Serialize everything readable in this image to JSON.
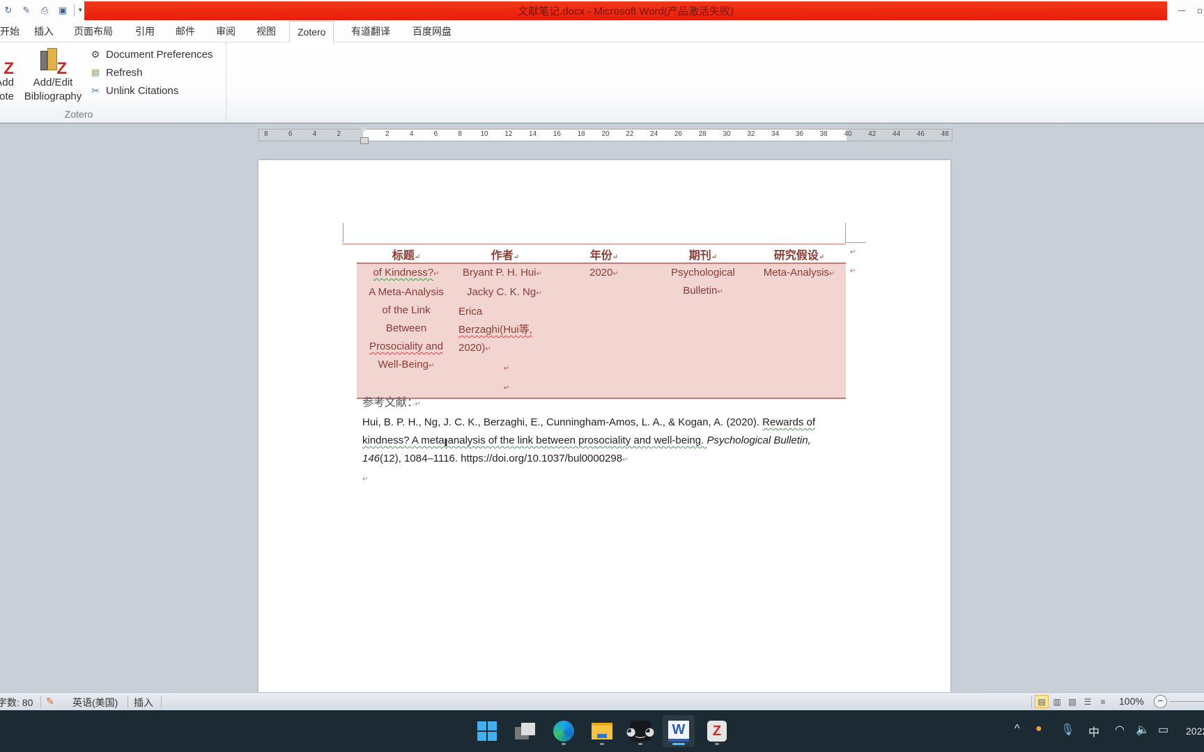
{
  "window": {
    "title": "文献笔记.docx - Microsoft Word(产品激活失败)",
    "title_bar_color": "#e81d0a",
    "minimize_icon": "minimize-icon",
    "maximize_icon": "maximize-icon"
  },
  "quick_access": {
    "items": [
      {
        "name": "redo-icon",
        "glyph": "↻"
      },
      {
        "name": "spellcheck-icon",
        "glyph": "✎"
      },
      {
        "name": "print-icon",
        "glyph": "⎙"
      },
      {
        "name": "print-preview-icon",
        "glyph": "▣"
      }
    ],
    "customize_glyph": "▾"
  },
  "ribbon_tabs": [
    {
      "label": "开始",
      "active": false
    },
    {
      "label": "插入",
      "active": false
    },
    {
      "label": "页面布局",
      "active": false
    },
    {
      "label": "引用",
      "active": false
    },
    {
      "label": "邮件",
      "active": false
    },
    {
      "label": "审阅",
      "active": false
    },
    {
      "label": "视图",
      "active": false
    },
    {
      "label": "Zotero",
      "active": true
    },
    {
      "label": "有道翻译",
      "active": false
    },
    {
      "label": "百度网盘",
      "active": false
    }
  ],
  "zotero_group": {
    "label": "Zotero",
    "add_note_line1": "Add",
    "add_note_line2": "Note",
    "add_bibliography_line1": "Add/Edit",
    "add_bibliography_line2": "Bibliography",
    "document_preferences": "Document Preferences",
    "refresh": "Refresh",
    "unlink_citations": "Unlink Citations"
  },
  "ruler": {
    "left_ticks": [
      "8",
      "6",
      "4",
      "2"
    ],
    "right_ticks": [
      "2",
      "4",
      "6",
      "8",
      "10",
      "12",
      "14",
      "16",
      "18",
      "20",
      "22",
      "24",
      "26",
      "28",
      "30",
      "32",
      "34",
      "36",
      "38",
      "40",
      "42",
      "44",
      "46",
      "48"
    ]
  },
  "document": {
    "table": {
      "headers": [
        "标题",
        "作者",
        "年份",
        "期刊",
        "研究假设"
      ],
      "row": {
        "title_lines": [
          "of Kindness?",
          "A Meta-Analysis",
          "of the Link",
          "Between",
          "Prosociality and",
          "Well-Being"
        ],
        "author_lines": [
          "Bryant P. H. Hui",
          "Jacky C. K. Ng",
          "Erica",
          "Berzaghi(Hui等,",
          "2020)"
        ],
        "year": "2020",
        "journal_lines": [
          "Psychological",
          "Bulletin"
        ],
        "hypothesis": "Meta-Analysis"
      },
      "text_color": "#8c3a33",
      "fill_color": "#f2d5d1"
    },
    "references_label": "参考文献：",
    "reference": {
      "authors": "Hui, B. P. H., Ng, J. C. K., Berzaghi, E., Cunningham-Amos, L. A., & Kogan, A. (2020). ",
      "title_part1": "Rewards of",
      "title_part2": "kindness? A meta-analysis of the link between prosociality and well-being. ",
      "journal": "Psychological Bulletin,",
      "volume": "146",
      "issue_pages": "(12), 1084–1116. https://doi.org/10.1037/bul0000298"
    },
    "paragraph_mark": "↵"
  },
  "statusbar": {
    "word_count": "字数: 80",
    "language": "英语(美国)",
    "mode": "插入",
    "zoom": "100%",
    "zoom_out": "−"
  },
  "taskbar": {
    "apps": [
      "start",
      "task-view",
      "edge",
      "file-explorer",
      "bilibili",
      "word",
      "zotero"
    ],
    "tray": {
      "chevron": "^",
      "ime": "中",
      "clock_partial": "2022"
    }
  }
}
